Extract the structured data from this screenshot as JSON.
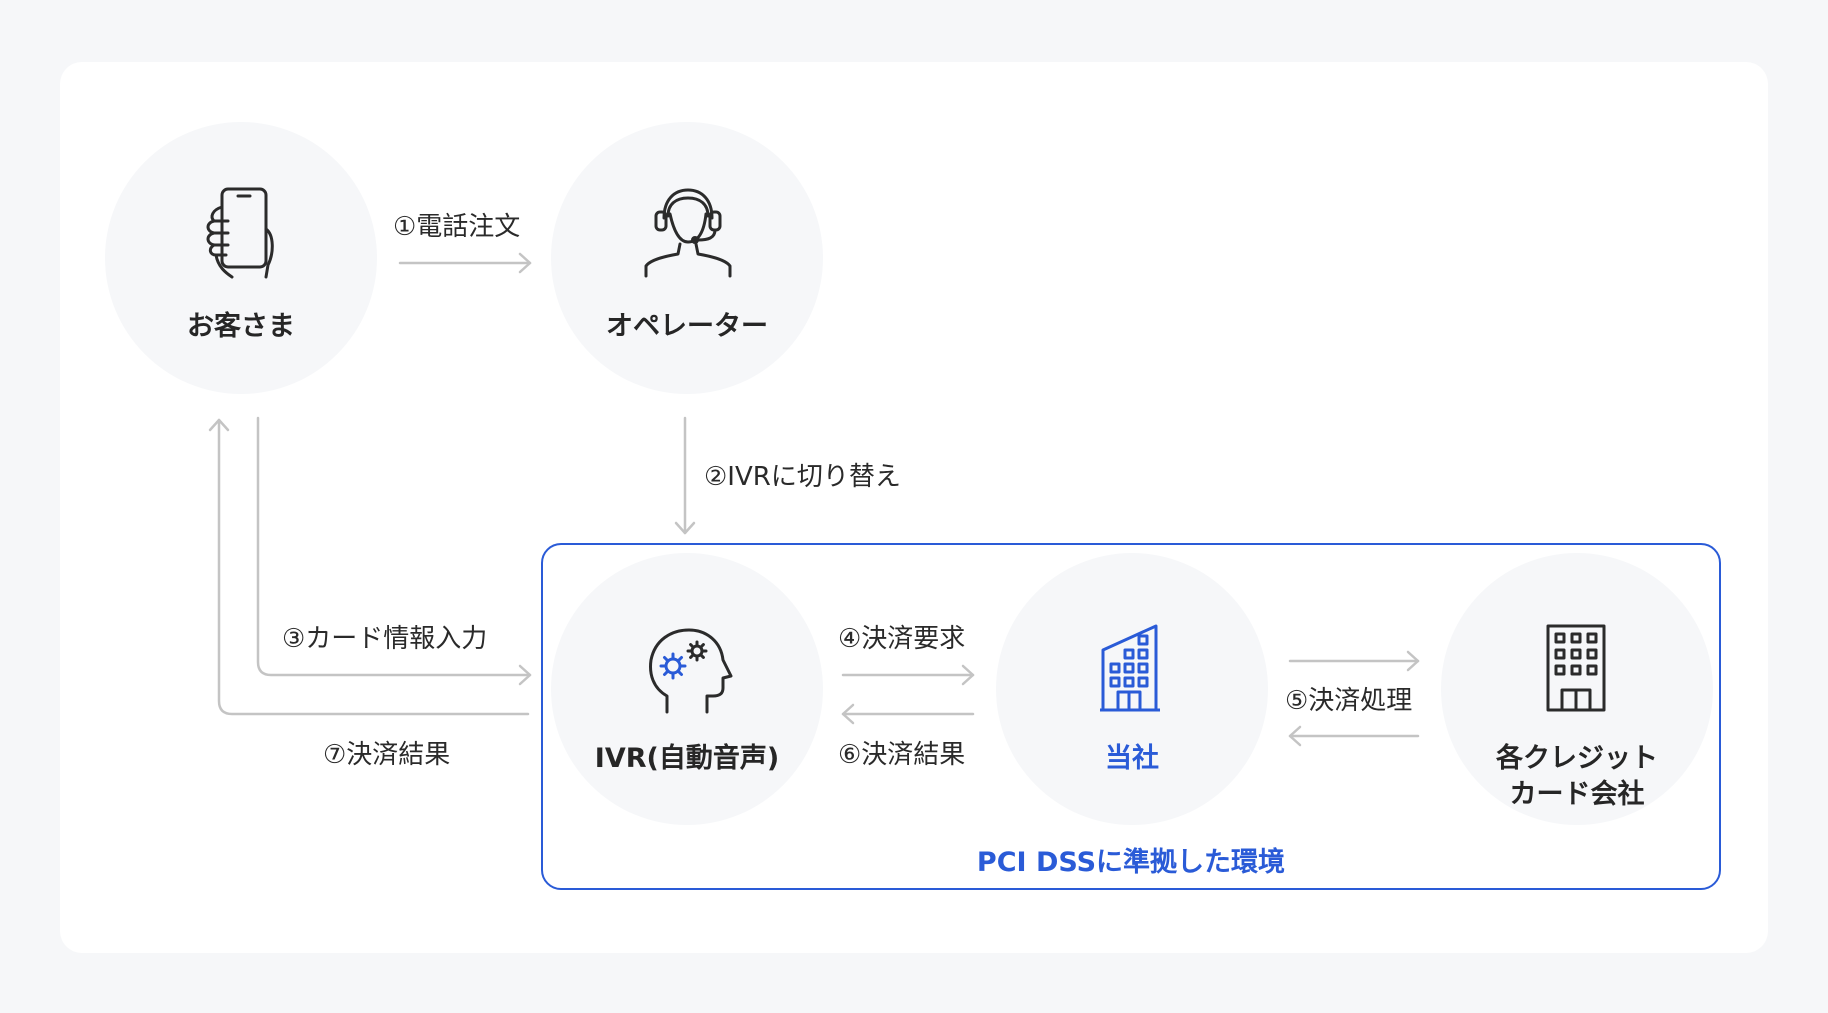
{
  "nodes": {
    "customer": {
      "label": "お客さま",
      "icon": "smartphone-hand-icon"
    },
    "operator": {
      "label": "オペレーター",
      "icon": "headset-operator-icon"
    },
    "ivr": {
      "label": "IVR(自動音声)",
      "icon": "head-gears-icon"
    },
    "company": {
      "label": "当社",
      "icon": "building-icon"
    },
    "card_company": {
      "label_line1": "各クレジット",
      "label_line2": "カード会社",
      "icon": "office-building-icon"
    }
  },
  "edges": {
    "step1": "①電話注文",
    "step2": "②IVRに切り替え",
    "step3": "③カード情報入力",
    "step4": "④決済要求",
    "step5": "⑤決済処理",
    "step6": "⑥決済結果",
    "step7": "⑦決済結果"
  },
  "pci_label": "PCI DSSに準拠した環境",
  "colors": {
    "accent": "#2a5bd7",
    "circle_bg": "#f6f7f9",
    "arrow": "#c4c4c4",
    "icon": "#2b2b2b"
  }
}
